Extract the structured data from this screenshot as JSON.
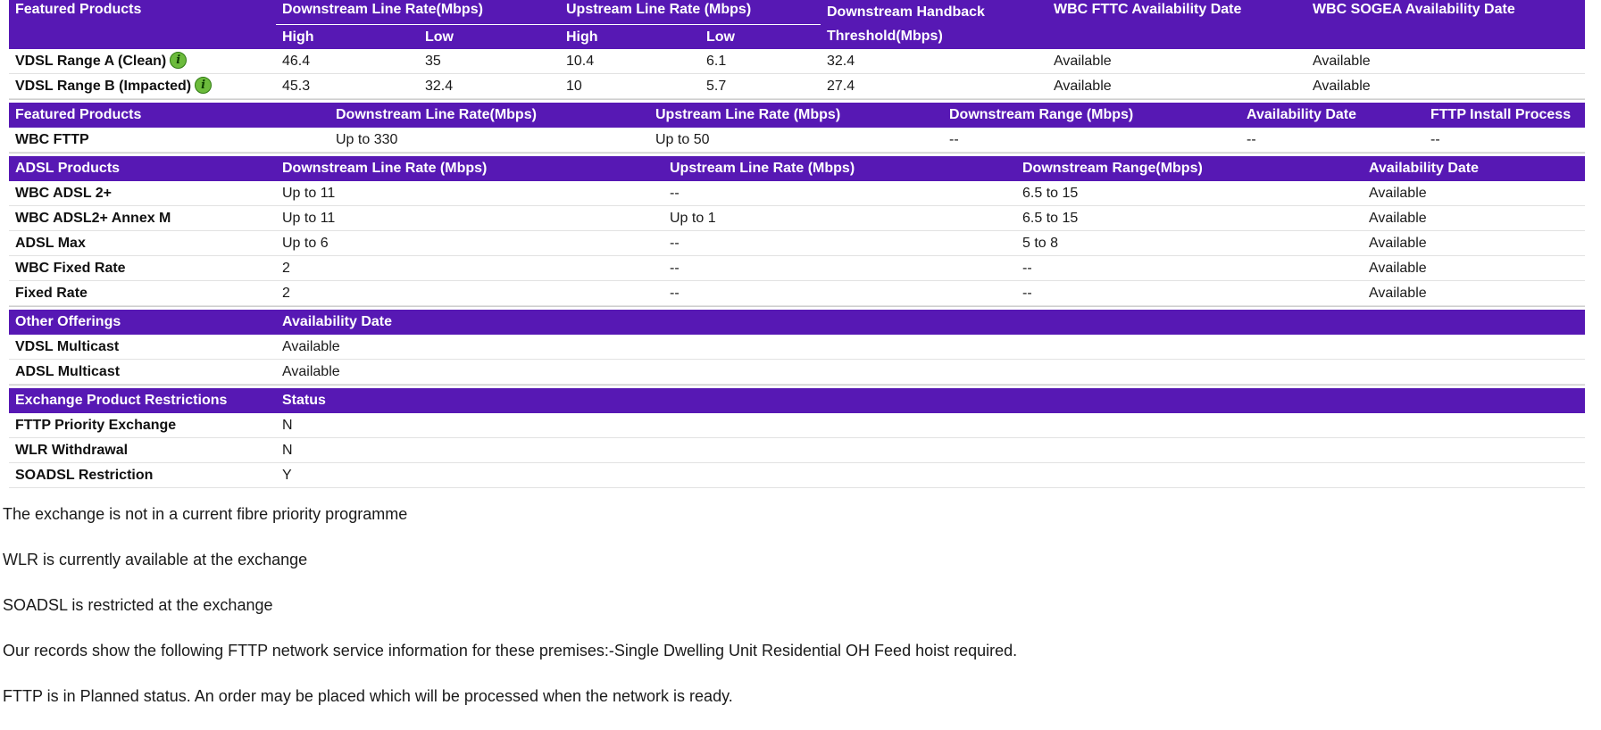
{
  "vdsl": {
    "headers": {
      "products": "Featured Products",
      "downstream": "Downstream Line Rate(Mbps)",
      "upstream": "Upstream Line Rate (Mbps)",
      "threshold": "Downstream Handback Threshold(Mbps)",
      "fttc": "WBC FTTC Availability Date",
      "sogea": "WBC SOGEA Availability Date",
      "high": "High",
      "low": "Low"
    },
    "rows": [
      {
        "name": "VDSL Range A (Clean)",
        "down_high": "46.4",
        "down_low": "35",
        "up_high": "10.4",
        "up_low": "6.1",
        "threshold": "32.4",
        "fttc": "Available",
        "sogea": "Available"
      },
      {
        "name": "VDSL Range B (Impacted)",
        "down_high": "45.3",
        "down_low": "32.4",
        "up_high": "10",
        "up_low": "5.7",
        "threshold": "27.4",
        "fttc": "Available",
        "sogea": "Available"
      }
    ]
  },
  "fttp": {
    "headers": [
      "Featured Products",
      "Downstream Line Rate(Mbps)",
      "Upstream Line Rate (Mbps)",
      "Downstream Range (Mbps)",
      "Availability Date",
      "FTTP Install Process"
    ],
    "rows": [
      [
        "WBC FTTP",
        "Up to 330",
        "Up to 50",
        "--",
        "--",
        "--"
      ]
    ]
  },
  "adsl": {
    "headers": [
      "ADSL Products",
      "Downstream Line Rate (Mbps)",
      "Upstream Line Rate (Mbps)",
      "Downstream Range(Mbps)",
      "Availability Date"
    ],
    "rows": [
      [
        "WBC ADSL 2+",
        "Up to 11",
        "--",
        "6.5 to 15",
        "Available"
      ],
      [
        "WBC ADSL2+ Annex M",
        "Up to 11",
        "Up to 1",
        "6.5 to 15",
        "Available"
      ],
      [
        "ADSL Max",
        "Up to 6",
        "--",
        "5 to 8",
        "Available"
      ],
      [
        "WBC Fixed Rate",
        "2",
        "--",
        "--",
        "Available"
      ],
      [
        "Fixed Rate",
        "2",
        "--",
        "--",
        "Available"
      ]
    ]
  },
  "other": {
    "headers": [
      "Other Offerings",
      "Availability Date"
    ],
    "rows": [
      [
        "VDSL Multicast",
        "Available"
      ],
      [
        "ADSL Multicast",
        "Available"
      ]
    ]
  },
  "restrictions": {
    "headers": [
      "Exchange Product Restrictions",
      "Status"
    ],
    "rows": [
      [
        "FTTP Priority Exchange",
        "N"
      ],
      [
        "WLR Withdrawal",
        "N"
      ],
      [
        "SOADSL Restriction",
        "Y"
      ]
    ]
  },
  "notes": [
    "The exchange is not in a current fibre priority programme",
    "WLR is currently available at the exchange",
    "SOADSL is restricted at the exchange",
    "Our records show the following FTTP network service information for these premises:-Single Dwelling Unit Residential OH Feed hoist required.",
    "FTTP is in Planned status. An order may be placed which will be processed when the network is ready."
  ],
  "icons": {
    "info": "info-icon"
  },
  "colors": {
    "header_bg": "#5718b4",
    "header_text": "#ffffff",
    "info_icon": "#6cbb3c"
  }
}
